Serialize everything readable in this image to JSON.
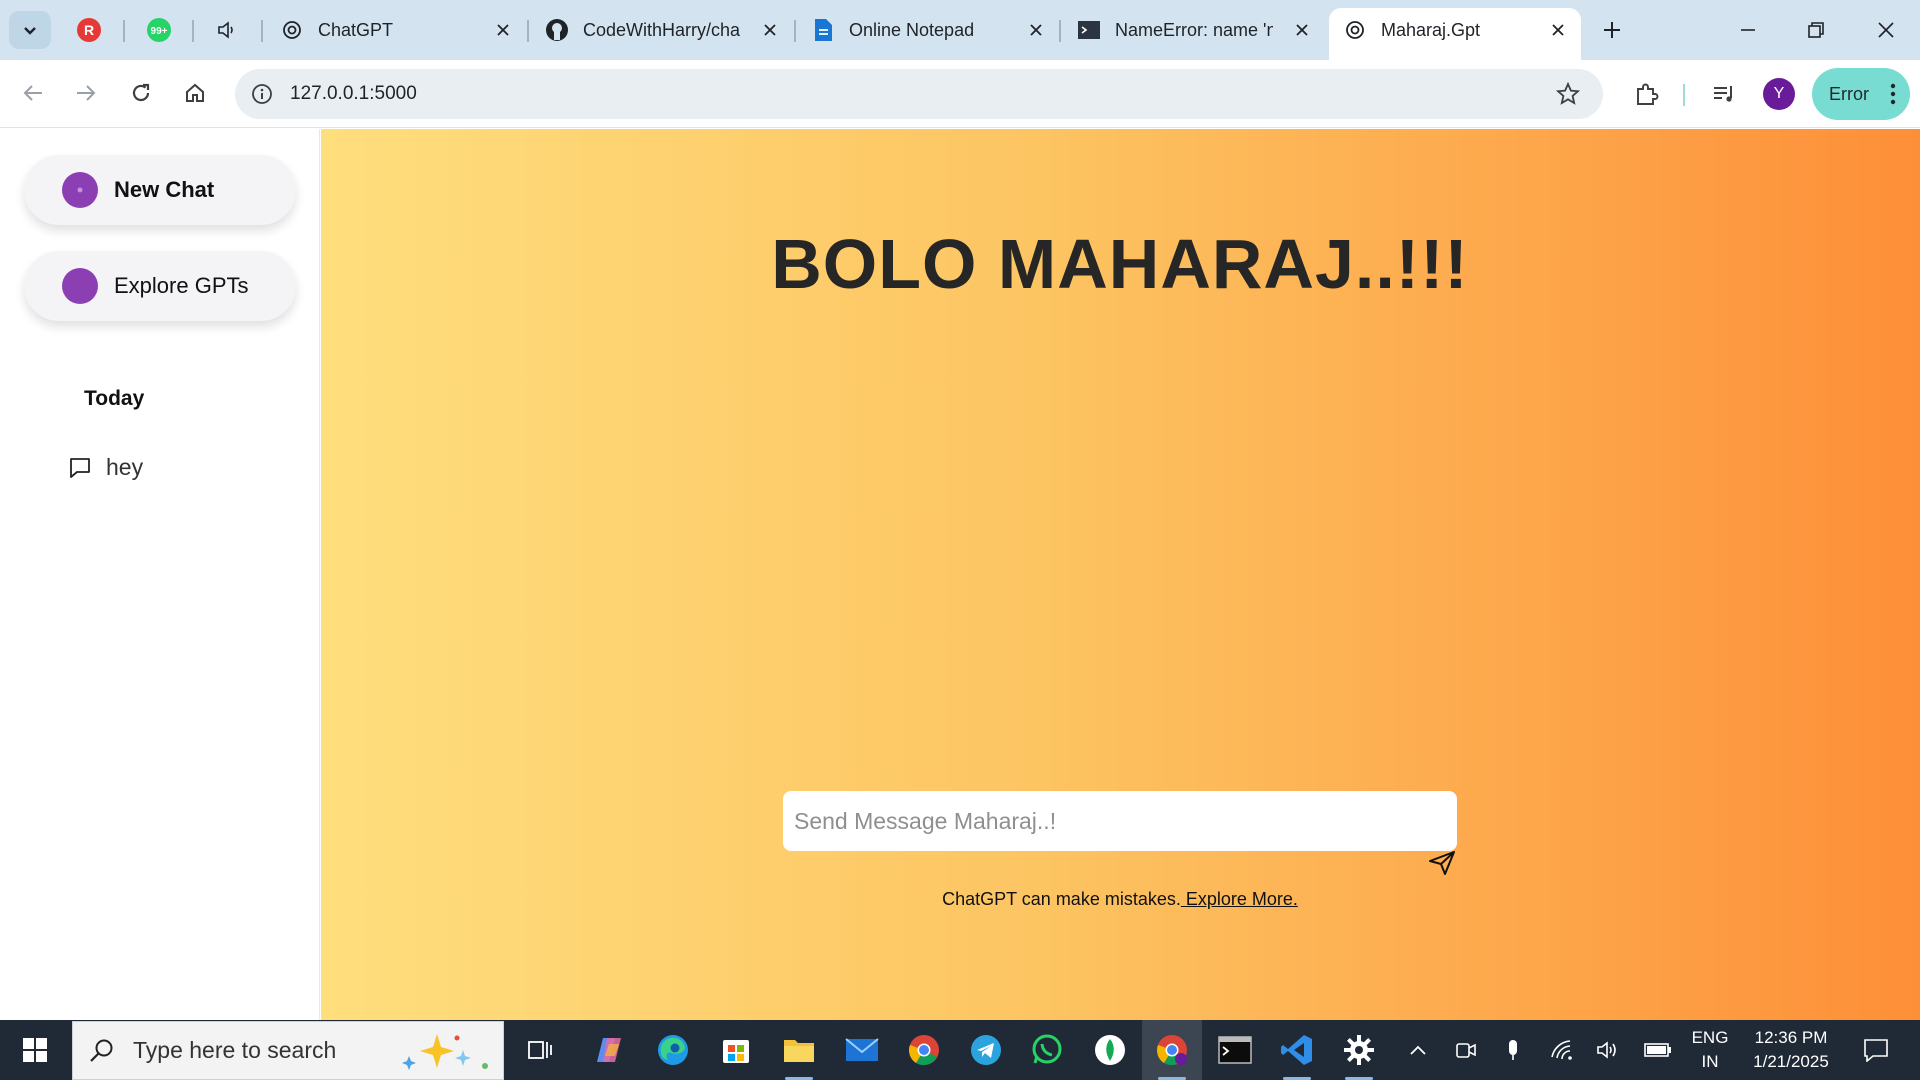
{
  "browser": {
    "tabs": [
      {
        "title": "ChatGPT",
        "icon": "openai-icon"
      },
      {
        "title": "CodeWithHarry/cha",
        "icon": "github-icon"
      },
      {
        "title": "Online Notepad",
        "icon": "document-icon"
      },
      {
        "title": "NameError: name 'n",
        "icon": "terminal-icon"
      },
      {
        "title": "Maharaj.Gpt",
        "icon": "openai-icon",
        "active": true
      }
    ],
    "pinned_badges": {
      "whatsapp": "99+",
      "first": "R"
    },
    "url": "127.0.0.1:5000",
    "profile_initial": "Y",
    "error_label": "Error"
  },
  "sidebar": {
    "new_chat": "New Chat",
    "explore": "Explore GPTs",
    "section_today": "Today",
    "history": [
      "hey"
    ]
  },
  "main": {
    "headline": "BOLO MAHARAJ..!!!",
    "input_placeholder": "Send Message Maharaj..!",
    "disclaimer_text": "ChatGPT can make mistakes.",
    "disclaimer_link": " Explore More."
  },
  "taskbar": {
    "search_placeholder": "Type here to search",
    "lang_line1": "ENG",
    "lang_line2": "IN",
    "time": "12:36 PM",
    "date": "1/21/2025"
  },
  "colors": {
    "gradient_start": "#ffde7d",
    "gradient_end": "#fd8f38",
    "accent_purple": "#8b3fb3",
    "tabstrip": "#d3e3ef"
  }
}
